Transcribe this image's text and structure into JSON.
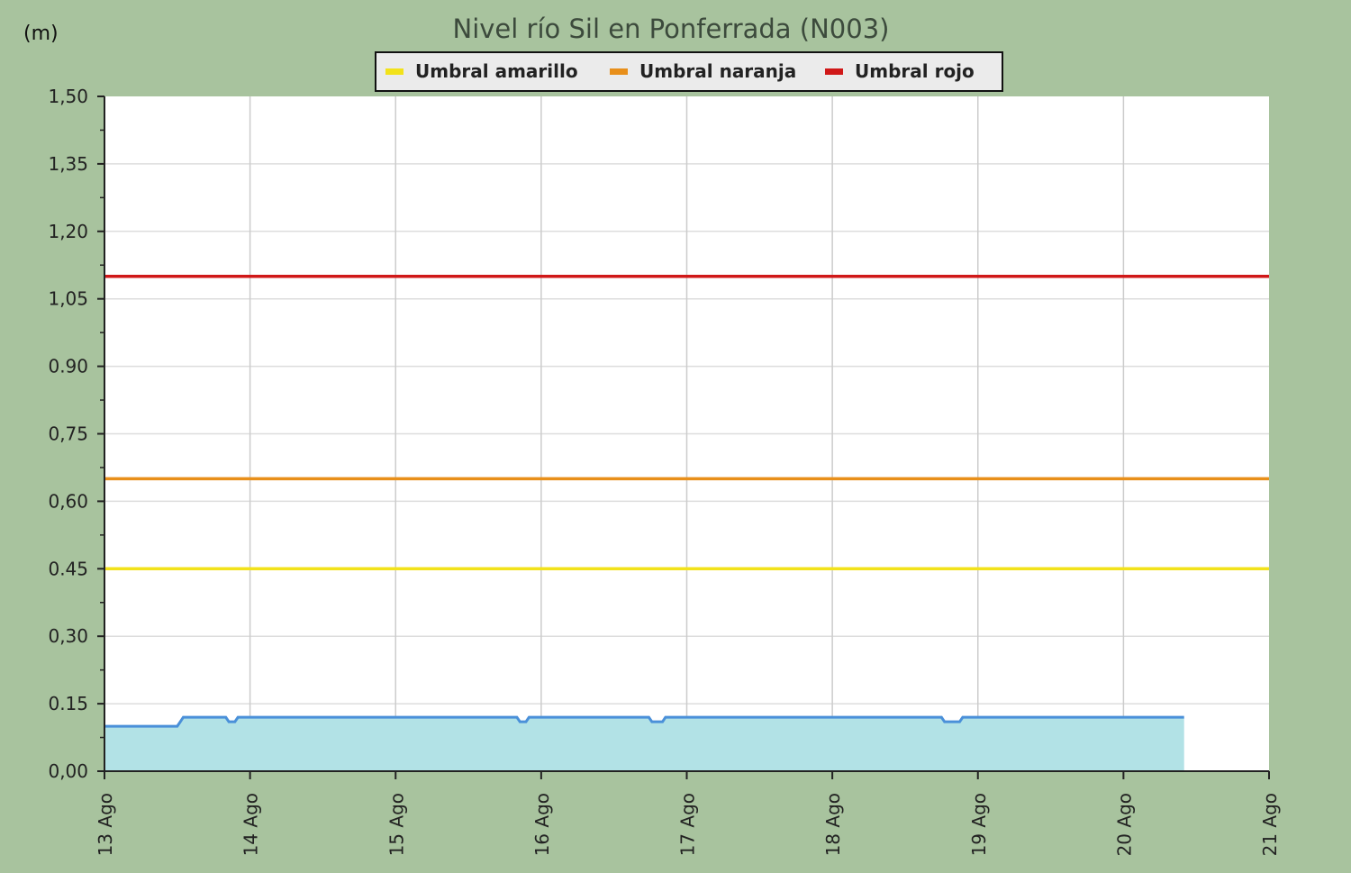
{
  "chart_data": {
    "type": "area",
    "title": "Nivel río Sil en Ponferrada  (N003)",
    "ylabel": "(m)",
    "xlabel": "",
    "ylim": [
      0,
      1.5
    ],
    "y_ticks": [
      "0,00",
      "0.15",
      "0,30",
      "0.45",
      "0,60",
      "0,75",
      "0.90",
      "1,05",
      "1,20",
      "1,35",
      "1,50"
    ],
    "x_ticks": [
      "13 Ago",
      "14 Ago",
      "15 Ago",
      "16 Ago",
      "17 Ago",
      "18 Ago",
      "19 Ago",
      "20 Ago",
      "21 Ago"
    ],
    "xlim_days": [
      "13 Ago",
      "21 Ago"
    ],
    "grid": true,
    "legend_position": "top-center",
    "colors": {
      "background": "#a8c39e",
      "plot": "#ffffff",
      "level_line": "#4a90d9",
      "level_fill": "#b2e2e6",
      "yellow": "#f2e21a",
      "orange": "#e88f1a",
      "red": "#d01818"
    },
    "thresholds": [
      {
        "name": "Umbral amarillo",
        "value": 0.45,
        "color": "#f2e21a"
      },
      {
        "name": "Umbral naranja",
        "value": 0.65,
        "color": "#e88f1a"
      },
      {
        "name": "Umbral rojo",
        "value": 1.1,
        "color": "#d01818"
      }
    ],
    "series": [
      {
        "type": "area",
        "points": [
          [
            "13 Ago 00:00",
            0.1
          ],
          [
            "13 Ago 12:00",
            0.1
          ],
          [
            "13 Ago 12:30",
            0.11
          ],
          [
            "13 Ago 13:00",
            0.12
          ],
          [
            "13 Ago 20:00",
            0.12
          ],
          [
            "13 Ago 20:30",
            0.11
          ],
          [
            "13 Ago 21:30",
            0.11
          ],
          [
            "13 Ago 22:00",
            0.12
          ],
          [
            "15 Ago 20:00",
            0.12
          ],
          [
            "15 Ago 20:30",
            0.11
          ],
          [
            "15 Ago 21:30",
            0.11
          ],
          [
            "15 Ago 22:00",
            0.12
          ],
          [
            "16 Ago 17:45",
            0.12
          ],
          [
            "16 Ago 18:15",
            0.11
          ],
          [
            "16 Ago 20:00",
            0.11
          ],
          [
            "16 Ago 20:30",
            0.12
          ],
          [
            "18 Ago 18:00",
            0.12
          ],
          [
            "18 Ago 18:30",
            0.11
          ],
          [
            "18 Ago 21:00",
            0.11
          ],
          [
            "18 Ago 21:30",
            0.12
          ],
          [
            "20 Ago 10:00",
            0.12
          ]
        ]
      }
    ]
  }
}
